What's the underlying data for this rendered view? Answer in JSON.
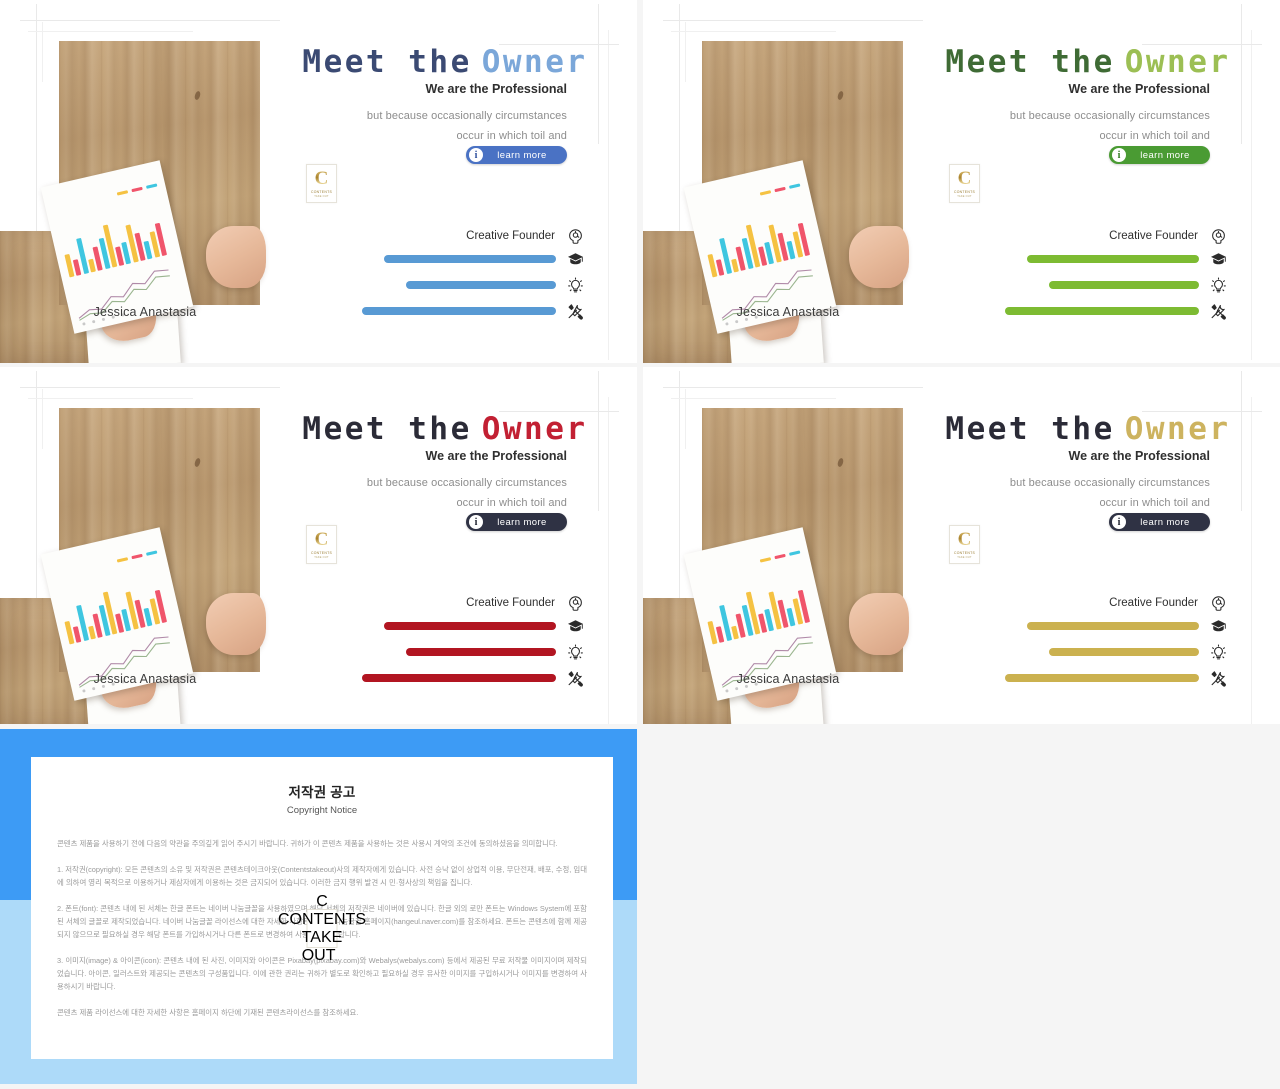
{
  "slides": [
    {
      "id": "slide-blue",
      "headline_part1": "Meet  the",
      "headline_part2": "Owner",
      "headline_color1": "#3b4a73",
      "headline_color2": "#7ba7d9",
      "subhead": "We are the Professional",
      "body_line1": "but because occasionally circumstances",
      "body_line2": "occur in which toil and",
      "button_label": "learn  more",
      "button_icon": "info-icon",
      "button_color": "#4a72c4",
      "button_icon_color": "#2d4f9e",
      "accent": "#589ad4",
      "caption": "Jessica Anastasia",
      "role_label": "Creative Founder",
      "skills": [
        {
          "icon": "graduation-cap-icon",
          "value": 78
        },
        {
          "icon": "lightbulb-icon",
          "value": 68
        },
        {
          "icon": "tools-icon",
          "value": 88
        }
      ],
      "role_icon": "head-idea-icon"
    },
    {
      "id": "slide-green",
      "headline_part1": "Meet  the",
      "headline_part2": "Owner",
      "headline_color1": "#3f6b35",
      "headline_color2": "#9cbf54",
      "subhead": "We are the Professional",
      "body_line1": "but because occasionally circumstances",
      "body_line2": "occur in which toil and",
      "button_label": "learn  more",
      "button_icon": "info-icon",
      "button_color": "#4a9b33",
      "button_icon_color": "#2f7a1e",
      "accent": "#7dbb32",
      "caption": "Jessica Anastasia",
      "role_label": "Creative Founder",
      "skills": [
        {
          "icon": "graduation-cap-icon",
          "value": 78
        },
        {
          "icon": "lightbulb-icon",
          "value": 68
        },
        {
          "icon": "tools-icon",
          "value": 88
        }
      ],
      "role_icon": "head-idea-icon"
    },
    {
      "id": "slide-red",
      "headline_part1": "Meet  the",
      "headline_part2": "Owner",
      "headline_color1": "#2b2b37",
      "headline_color2": "#c22033",
      "subhead": "We are the Professional",
      "body_line1": "but because occasionally circumstances",
      "body_line2": "occur in which toil and",
      "button_label": "learn  more",
      "button_icon": "info-icon",
      "button_color": "#2f3244",
      "button_icon_color": "#1b1e2c",
      "accent": "#b21521",
      "caption": "Jessica Anastasia",
      "role_label": "Creative Founder",
      "skills": [
        {
          "icon": "graduation-cap-icon",
          "value": 78
        },
        {
          "icon": "lightbulb-icon",
          "value": 68
        },
        {
          "icon": "tools-icon",
          "value": 88
        }
      ],
      "role_icon": "head-idea-icon"
    },
    {
      "id": "slide-gold",
      "headline_part1": "Meet  the",
      "headline_part2": "Owner",
      "headline_color1": "#2b2b37",
      "headline_color2": "#cdb35f",
      "subhead": "We are the Professional",
      "body_line1": "but because occasionally circumstances",
      "body_line2": "occur in which toil and",
      "button_label": "learn  more",
      "button_icon": "info-icon",
      "button_color": "#2f3244",
      "button_icon_color": "#1b1e2c",
      "accent": "#cbb14f",
      "caption": "Jessica Anastasia",
      "role_label": "Creative Founder",
      "skills": [
        {
          "icon": "graduation-cap-icon",
          "value": 78
        },
        {
          "icon": "lightbulb-icon",
          "value": 68
        },
        {
          "icon": "tools-icon",
          "value": 88
        }
      ],
      "role_icon": "head-idea-icon"
    }
  ],
  "brand_logo": {
    "letter": "C",
    "line1": "CONTENTS",
    "line2": "TAKE  OUT"
  },
  "copyright": {
    "title": "저작권 공고",
    "subtitle": "Copyright Notice",
    "paragraphs": [
      "콘텐츠 제품을 사용하기 전에 다음의 약관을 주의깊게 읽어 주시기 바랍니다. 귀하가 이 콘텐츠 제품을 사용하는 것은 사용시 계약의 조건에 동의하셨음을 의미합니다.",
      "1. 저작권(copyright): 모든 콘텐츠의 소유 및 저작권은 콘텐츠테이크아웃(Contentstakeout)사의 제작자에게 있습니다. 사전 승낙 없이 상업적 이용, 무단전재, 배포, 수정, 임대에 의하여 영리 목적으로 이용하거나 제삼자에게 이용하는 것은 금지되어 있습니다. 이러한 금지 행위 발견 시 민·형사상의 책임을 집니다.",
      "2. 폰트(font): 콘텐츠 내에 된 서체는 한글 폰트는 네이버 나눔글꼴을 사용하였으며 해당 서체의 저작권은 네이버에 있습니다. 한글 외의 로만 폰트는 Windows System에 포함된 서체의 글꼴로 제작되었습니다. 네이버 나눔글꼴 라이선스에 대한 자세한 사항은 네이버 나눔글꼴 홈페이지(hangeul.naver.com)를 참조하세요. 폰트는 콘텐츠에 함께 제공되지 않으므로 필요하실 경우 해당 폰트를 가입하시거나 다른 폰트로 변경하여 사용하시기 바랍니다.",
      "3. 이미지(image) & 아이콘(icon): 콘텐츠 내에 된 사진, 이미지와 아이콘은 Pixabay(pixabay.com)와 Webalys(webalys.com) 등에서 제공된 무료 저작물 이미지이며 제작되었습니다. 아이콘, 일러스트와 제공되는 콘텐츠의 구성품입니다. 이에 관한 권리는 귀하가 별도로 확인하고 필요하실 경우 유사한 이미지를 구입하시거나 이미지를 변경하여 사용하시기 바랍니다.",
      "콘텐츠 제품 라이선스에 대한 자세한 사항은 홈페이지 하단에 기재된 콘텐츠라이선스를 참조하세요."
    ],
    "border_color_top": "#3d9bf5",
    "border_color_bottom": "#addaf9"
  },
  "mini_chart": {
    "type": "bar",
    "values": [
      42,
      30,
      66,
      24,
      44,
      58,
      80,
      36,
      40,
      70,
      52,
      34,
      48,
      62
    ],
    "colors": [
      "#f5c242",
      "#f0556b",
      "#3fc6e0"
    ],
    "legend": [
      "series-a",
      "series-b",
      "series-c"
    ]
  }
}
